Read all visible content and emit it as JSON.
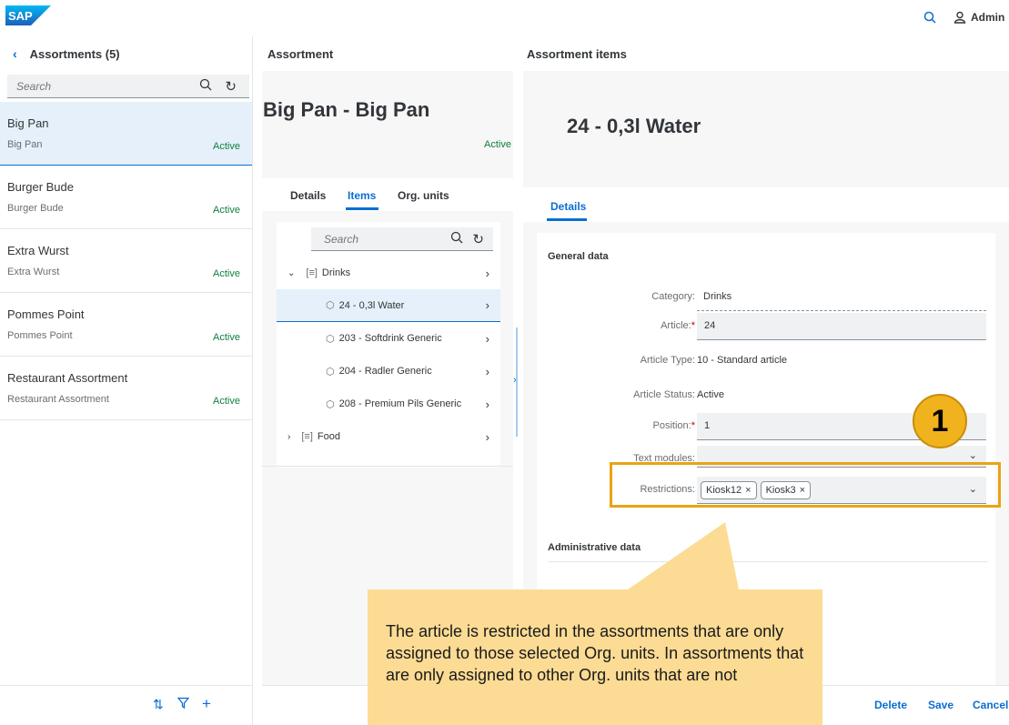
{
  "app": {
    "logo": "SAP",
    "user": "Admin"
  },
  "left": {
    "title": "Assortments (5)",
    "search_placeholder": "Search",
    "items": [
      {
        "title": "Big Pan",
        "subtitle": "Big Pan",
        "status": "Active"
      },
      {
        "title": "Burger Bude",
        "subtitle": "Burger Bude",
        "status": "Active"
      },
      {
        "title": "Extra Wurst",
        "subtitle": "Extra Wurst",
        "status": "Active"
      },
      {
        "title": "Pommes Point",
        "subtitle": "Pommes Point",
        "status": "Active"
      },
      {
        "title": "Restaurant Assortment",
        "subtitle": "Restaurant Assortment",
        "status": "Active"
      }
    ]
  },
  "mid": {
    "title": "Assortment",
    "object_title": "Big Pan - Big Pan",
    "status": "Active",
    "tabs": [
      "Details",
      "Items",
      "Org. units"
    ],
    "active_tab": "Items",
    "search_placeholder": "Search",
    "tree": [
      {
        "label": "Drinks",
        "kind": "group",
        "expanded": true
      },
      {
        "label": "24 - 0,3l Water",
        "kind": "item",
        "selected": true
      },
      {
        "label": "203 - Softdrink Generic",
        "kind": "item"
      },
      {
        "label": "204 - Radler Generic",
        "kind": "item"
      },
      {
        "label": "208 - Premium Pils Generic",
        "kind": "item"
      },
      {
        "label": "Food",
        "kind": "group",
        "expanded": false
      }
    ]
  },
  "right": {
    "title": "Assortment items",
    "object_title": "24 - 0,3l Water",
    "tab": "Details",
    "general_title": "General data",
    "fields": {
      "category": {
        "label": "Category:",
        "value": "Drinks"
      },
      "article": {
        "label": "Article:",
        "value": "24"
      },
      "article_type": {
        "label": "Article Type:",
        "value": "10 - Standard article"
      },
      "article_status": {
        "label": "Article Status:",
        "value": "Active"
      },
      "position": {
        "label": "Position:",
        "value": "1"
      },
      "text_modules": {
        "label": "Text modules:",
        "value": ""
      },
      "restrictions": {
        "label": "Restrictions:",
        "tokens": [
          "Kiosk12",
          "Kiosk3"
        ]
      }
    },
    "admin_title": "Administrative data",
    "footer": {
      "delete": "Delete",
      "save": "Save",
      "cancel": "Cancel"
    }
  },
  "annotation": {
    "badge": "1",
    "callout": "The article is restricted in the assortments that are only assigned to those selected Org. units. In assortments that are only assigned to other Org. units that are not"
  },
  "colors": {
    "accent": "#0a6ed1",
    "positive": "#107e3e",
    "highlight": "#e8a414",
    "callout": "#fcdb94"
  }
}
